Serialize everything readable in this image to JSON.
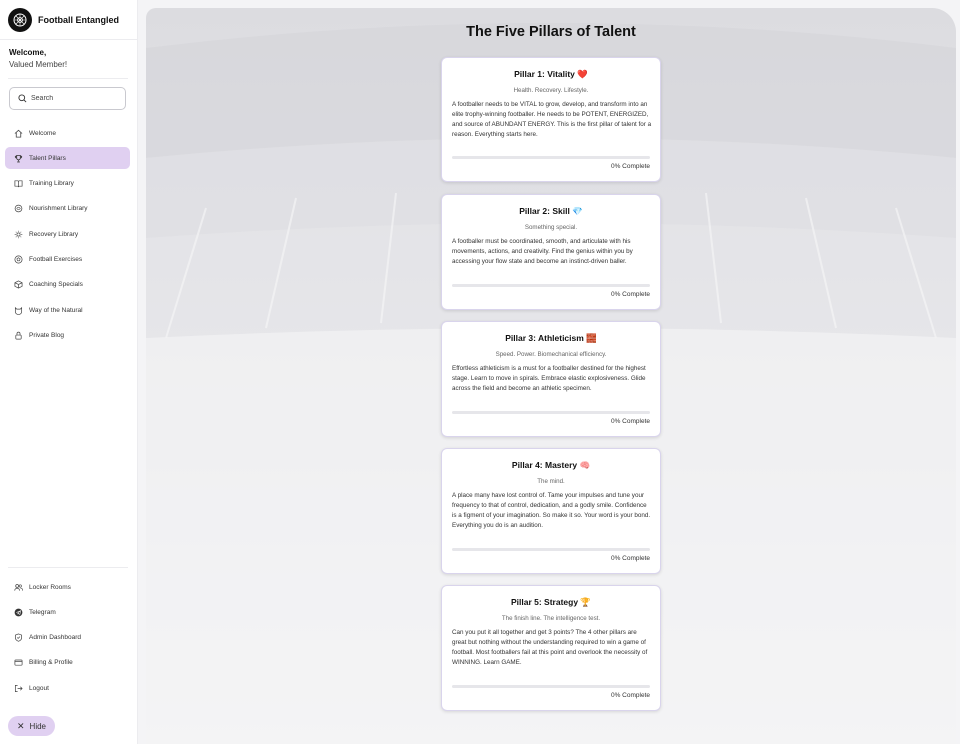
{
  "brand": {
    "name": "Football Entangled"
  },
  "welcome": {
    "line1": "Welcome,",
    "line2": "Valued Member!"
  },
  "search": {
    "placeholder": "Search"
  },
  "nav": [
    {
      "label": "Welcome",
      "icon": "home-icon"
    },
    {
      "label": "Talent Pillars",
      "icon": "trophy-icon",
      "active": true
    },
    {
      "label": "Training Library",
      "icon": "book-icon"
    },
    {
      "label": "Nourishment Library",
      "icon": "food-icon"
    },
    {
      "label": "Recovery Library",
      "icon": "sun-icon"
    },
    {
      "label": "Football Exercises",
      "icon": "ball-icon"
    },
    {
      "label": "Coaching Specials",
      "icon": "box-icon"
    },
    {
      "label": "Way of the Natural",
      "icon": "cat-icon"
    },
    {
      "label": "Private Blog",
      "icon": "lock-icon"
    }
  ],
  "bottom_nav": [
    {
      "label": "Locker Rooms",
      "icon": "users-icon"
    },
    {
      "label": "Telegram",
      "icon": "telegram-icon"
    },
    {
      "label": "Admin Dashboard",
      "icon": "shield-icon"
    },
    {
      "label": "Billing & Profile",
      "icon": "card-icon"
    },
    {
      "label": "Logout",
      "icon": "logout-icon"
    }
  ],
  "hide": {
    "label": "Hide"
  },
  "page": {
    "title": "The Five Pillars of Talent"
  },
  "pillars": [
    {
      "title": "Pillar 1: Vitality ❤️",
      "subtitle": "Health. Recovery. Lifestyle.",
      "body": "A footballer needs to be VITAL to grow, develop, and transform into an elite trophy-winning footballer. He needs to be POTENT, ENERGIZED, and source of ABUNDANT ENERGY. This is the first pillar of talent for a reason. Everything starts here.",
      "progress": 0,
      "complete": "0% Complete"
    },
    {
      "title": "Pillar 2: Skill 💎",
      "subtitle": "Something special.",
      "body": "A footballer must be coordinated, smooth, and articulate with his movements, actions, and creativity. Find the genius within you by accessing your flow state and become an instinct-driven baller.",
      "progress": 0,
      "complete": "0% Complete"
    },
    {
      "title": "Pillar 3: Athleticism 🧱",
      "subtitle": "Speed. Power. Biomechanical efficiency.",
      "body": "Effortless athleticism is a must for a footballer destined for the highest stage. Learn to move in spirals. Embrace elastic explosiveness. Glide across the field and become an athletic specimen.",
      "progress": 0,
      "complete": "0% Complete"
    },
    {
      "title": "Pillar 4: Mastery 🧠",
      "subtitle": "The mind.",
      "body": "A place many have lost control of. Tame your impulses and tune your frequency to that of control, dedication, and a godly smile. Confidence is a figment of your imagination. So make it so. Your word is your bond. Everything you do is an audition.",
      "progress": 0,
      "complete": "0% Complete"
    },
    {
      "title": "Pillar 5: Strategy 🏆",
      "subtitle": "The finish line. The intelligence test.",
      "body": "Can you put it all together and get 3 points? The 4 other pillars are great but nothing without the understanding required to win a game of football. Most footballers fail at this point and overlook the necessity of WINNING. Learn GAME.",
      "progress": 0,
      "complete": "0% Complete"
    }
  ],
  "colors": {
    "accent": "#e0d0f1",
    "progress_fill": "#9b6fd1",
    "track": "#e6e6ea"
  }
}
